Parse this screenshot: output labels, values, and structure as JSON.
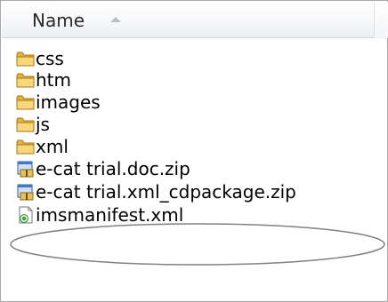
{
  "header": {
    "name_label": "Name"
  },
  "files": [
    {
      "name": "css",
      "type": "folder-icon"
    },
    {
      "name": "htm",
      "type": "folder-icon"
    },
    {
      "name": "images",
      "type": "folder-icon"
    },
    {
      "name": "js",
      "type": "folder-icon"
    },
    {
      "name": "xml",
      "type": "folder-icon"
    },
    {
      "name": "e-cat trial.doc.zip",
      "type": "zip-icon"
    },
    {
      "name": "e-cat trial.xml_cdpackage.zip",
      "type": "zip-icon"
    },
    {
      "name": "imsmanifest.xml",
      "type": "xml-document-icon"
    }
  ],
  "colors": {
    "folder": "#f2c94c",
    "ellipse": "#808080"
  }
}
